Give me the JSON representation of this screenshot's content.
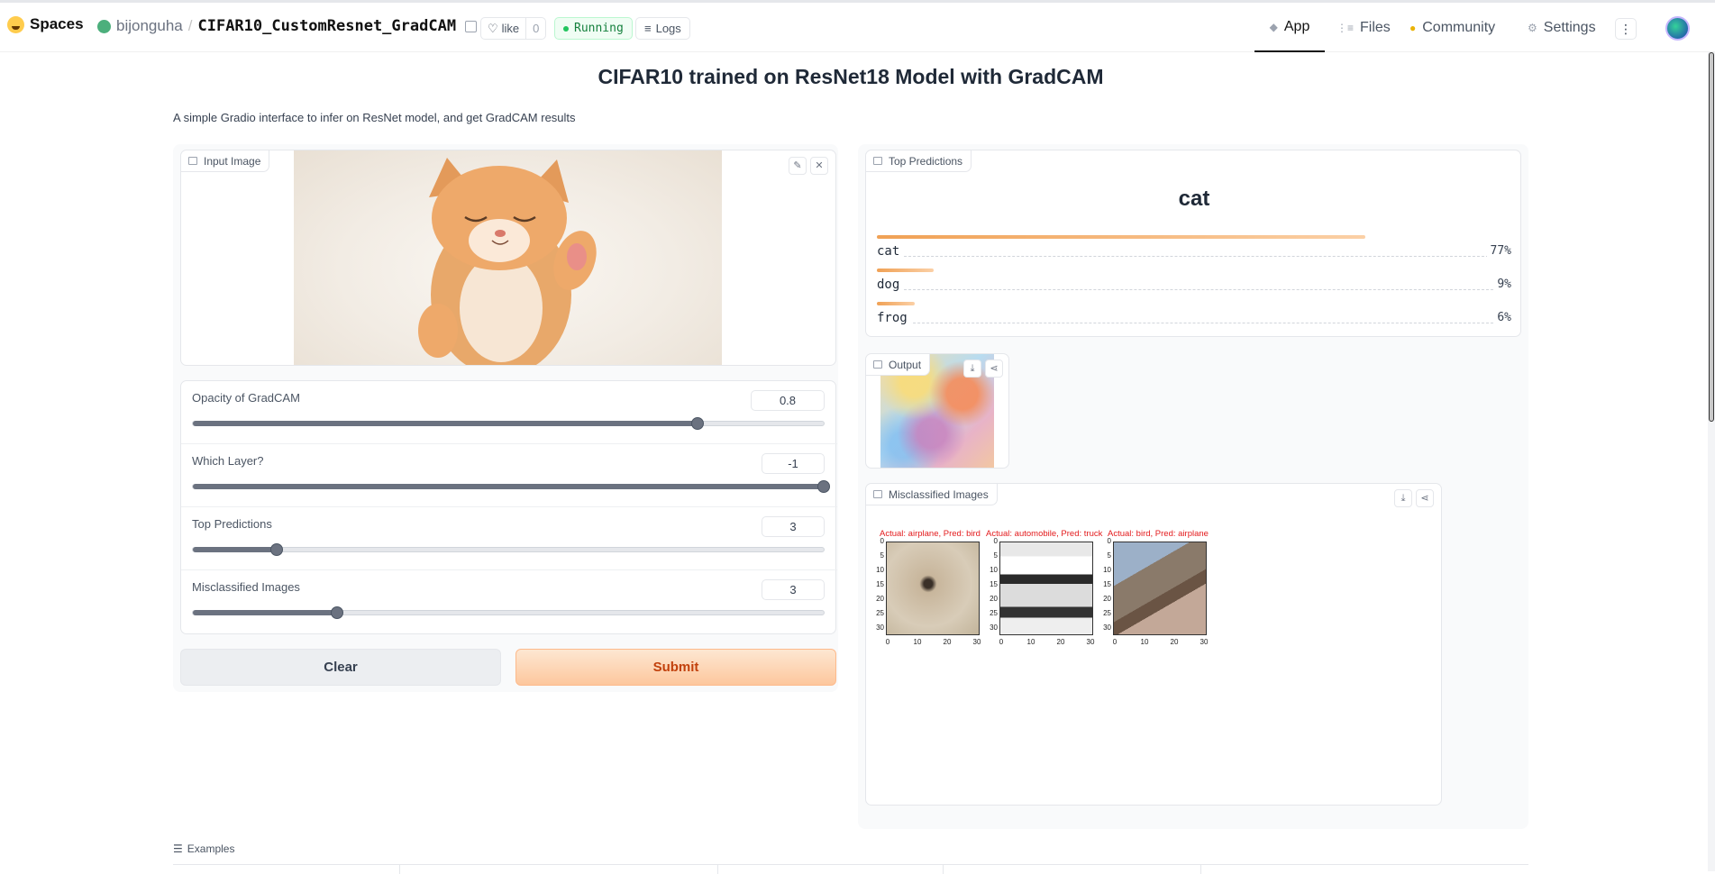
{
  "header": {
    "brand": "Spaces",
    "owner": "bijonguha",
    "separator": "/",
    "repo": "CIFAR10_CustomResnet_GradCAM",
    "like_label": "like",
    "like_count": "0",
    "status": "Running",
    "logs_label": "Logs",
    "nav": {
      "app": "App",
      "files": "Files",
      "community": "Community",
      "settings": "Settings"
    },
    "more_icon": "⋮"
  },
  "page": {
    "title": "CIFAR10 trained on ResNet18 Model with GradCAM",
    "description": "A simple Gradio interface to infer on ResNet model, and get GradCAM results"
  },
  "inputs": {
    "image_label": "Input Image",
    "sliders": [
      {
        "label": "Opacity of GradCAM",
        "value": "0.8",
        "fraction": 0.8
      },
      {
        "label": "Which Layer?",
        "value": "-1",
        "fraction": 1.0
      },
      {
        "label": "Top Predictions",
        "value": "3",
        "fraction": 0.133
      },
      {
        "label": "Misclassified Images",
        "value": "3",
        "fraction": 0.228
      }
    ],
    "clear_label": "Clear",
    "submit_label": "Submit"
  },
  "outputs": {
    "predictions_label": "Top Predictions",
    "top_label": "cat",
    "predictions": [
      {
        "name": "cat",
        "pct": "77%",
        "fraction": 0.77
      },
      {
        "name": "dog",
        "pct": "9%",
        "fraction": 0.09
      },
      {
        "name": "frog",
        "pct": "6%",
        "fraction": 0.06
      }
    ],
    "output_label": "Output",
    "misclassified_label": "Misclassified Images",
    "misclassified": [
      {
        "title": "Actual: airplane, Pred: bird"
      },
      {
        "title": "Actual: automobile, Pred: truck"
      },
      {
        "title": "Actual: bird, Pred: airplane"
      }
    ],
    "y_ticks": [
      "0",
      "5",
      "10",
      "15",
      "20",
      "25",
      "30"
    ],
    "x_ticks": [
      "0",
      "10",
      "20",
      "30"
    ]
  },
  "examples": {
    "label": "Examples"
  },
  "colors": {
    "accent": "#f97316",
    "bar": "#f0a155",
    "title_red": "#e31a1c"
  }
}
